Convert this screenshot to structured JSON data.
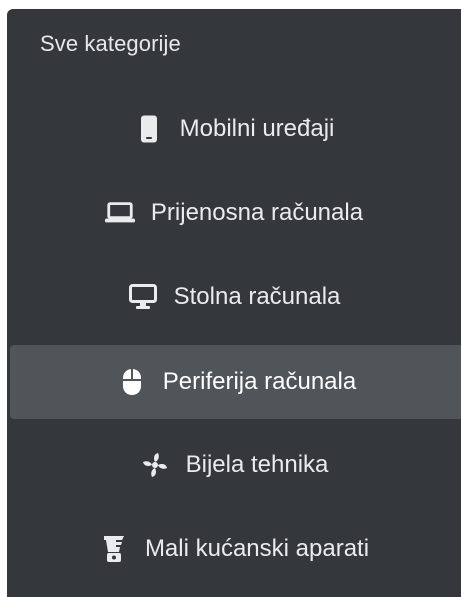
{
  "sidebar": {
    "header": "Sve kategorije",
    "items": [
      {
        "label": "Mobilni uređaji",
        "icon": "mobile-phone-icon",
        "active": false
      },
      {
        "label": "Prijenosna računala",
        "icon": "laptop-icon",
        "active": false
      },
      {
        "label": "Stolna računala",
        "icon": "desktop-monitor-icon",
        "active": false
      },
      {
        "label": "Periferija računala",
        "icon": "computer-mouse-icon",
        "active": true
      },
      {
        "label": "Bijela tehnika",
        "icon": "fan-icon",
        "active": false
      },
      {
        "label": "Mali kućanski aparati",
        "icon": "blender-icon",
        "active": false
      }
    ]
  },
  "colors": {
    "panel_bg": "#34383d",
    "active_bg": "#505559",
    "text": "#e9ebed"
  }
}
